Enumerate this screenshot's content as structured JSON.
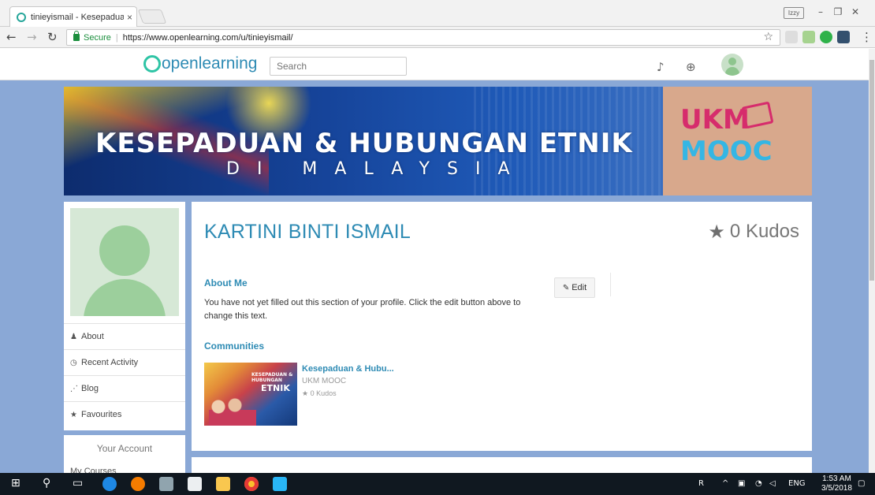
{
  "browser": {
    "tab_title": "tinieyismail - Kesepaduan",
    "tab_close": "×",
    "user_badge": "Izzy",
    "secure_label": "Secure",
    "url": "https://www.openlearning.com/u/tinieyismail/"
  },
  "site": {
    "logo_text": "openlearning",
    "search_placeholder": "Search"
  },
  "banner": {
    "title": "KESEPADUAN & HUBUNGAN ETNIK",
    "subtitle": "DI MALAYSIA",
    "brand_top": "UKM",
    "brand_bottom": "MOOC"
  },
  "sidebar": {
    "items": [
      {
        "label": "About",
        "icon": "user-icon"
      },
      {
        "label": "Recent Activity",
        "icon": "clock-icon"
      },
      {
        "label": "Blog",
        "icon": "rss-icon"
      },
      {
        "label": "Favourites",
        "icon": "star-icon"
      }
    ],
    "account_title": "Your Account",
    "account_next": "My Courses"
  },
  "profile": {
    "name": "KARTINI BINTI ISMAIL",
    "kudos": "0 Kudos",
    "about_heading": "About Me",
    "about_text": "You have not yet filled out this section of your profile. Click the edit button above to change this text.",
    "edit_label": "Edit",
    "communities_heading": "Communities"
  },
  "community": {
    "name": "Kesepaduan & Hubu...",
    "org": "UKM MOOC",
    "kudos": "0 Kudos",
    "thumb_label": "KESEPADUAN & HUBUNGAN",
    "thumb_word": "ETNIK"
  },
  "taskbar": {
    "lang": "ENG",
    "time": "1:53 AM",
    "date": "3/5/2018"
  },
  "colors": {
    "page_bg": "#8aa8d6",
    "accent": "#2e8bb4",
    "taskbar": "#101820"
  }
}
